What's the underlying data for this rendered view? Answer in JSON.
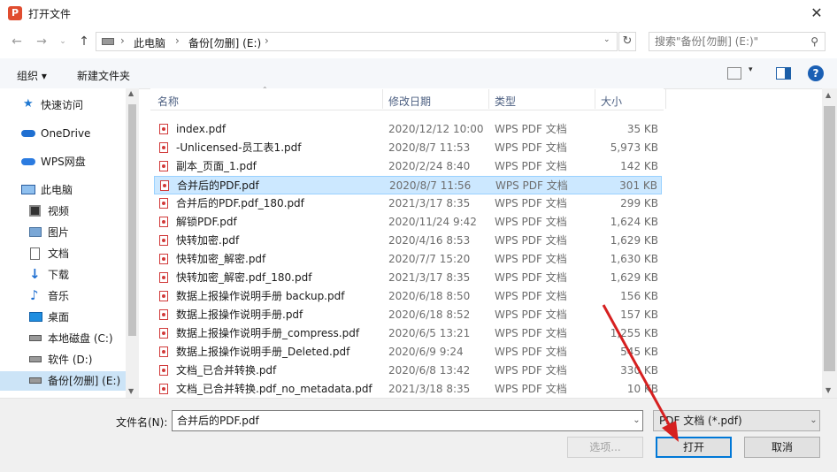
{
  "window": {
    "title": "打开文件",
    "app_icon": "P"
  },
  "address": {
    "path": [
      "此电脑",
      "备份[勿删] (E:)"
    ],
    "search_placeholder": "搜索\"备份[勿删] (E:)\""
  },
  "toolbar": {
    "organize": "组织 ▾",
    "new_folder": "新建文件夹"
  },
  "nav": [
    {
      "label": "快速访问",
      "icon": "star-icon"
    },
    {
      "label": "OneDrive",
      "icon": "cloud-icon"
    },
    {
      "label": "WPS网盘",
      "icon": "cloud-icon"
    },
    {
      "label": "此电脑",
      "icon": "computer-icon"
    },
    {
      "label": "视频",
      "icon": "video-icon"
    },
    {
      "label": "图片",
      "icon": "picture-icon"
    },
    {
      "label": "文档",
      "icon": "document-icon"
    },
    {
      "label": "下载",
      "icon": "download-icon"
    },
    {
      "label": "音乐",
      "icon": "music-icon"
    },
    {
      "label": "桌面",
      "icon": "desktop-icon"
    },
    {
      "label": "本地磁盘 (C:)",
      "icon": "drive-icon"
    },
    {
      "label": "软件 (D:)",
      "icon": "drive-icon"
    },
    {
      "label": "备份[勿删] (E:)",
      "icon": "drive-icon",
      "selected": true
    }
  ],
  "columns": {
    "name": "名称",
    "date": "修改日期",
    "type": "类型",
    "size": "大小"
  },
  "files": [
    {
      "name": "index.pdf",
      "date": "2020/12/12 10:00",
      "type": "WPS PDF 文档",
      "size": "35 KB"
    },
    {
      "name": "-Unlicensed-员工表1.pdf",
      "date": "2020/8/7 11:53",
      "type": "WPS PDF 文档",
      "size": "5,973 KB"
    },
    {
      "name": "副本_页面_1.pdf",
      "date": "2020/2/24 8:40",
      "type": "WPS PDF 文档",
      "size": "142 KB"
    },
    {
      "name": "合并后的PDF.pdf",
      "date": "2020/8/7 11:56",
      "type": "WPS PDF 文档",
      "size": "301 KB",
      "selected": true
    },
    {
      "name": "合并后的PDF.pdf_180.pdf",
      "date": "2021/3/17 8:35",
      "type": "WPS PDF 文档",
      "size": "299 KB"
    },
    {
      "name": "解锁PDF.pdf",
      "date": "2020/11/24 9:42",
      "type": "WPS PDF 文档",
      "size": "1,624 KB"
    },
    {
      "name": "快转加密.pdf",
      "date": "2020/4/16 8:53",
      "type": "WPS PDF 文档",
      "size": "1,629 KB"
    },
    {
      "name": "快转加密_解密.pdf",
      "date": "2020/7/7 15:20",
      "type": "WPS PDF 文档",
      "size": "1,630 KB"
    },
    {
      "name": "快转加密_解密.pdf_180.pdf",
      "date": "2021/3/17 8:35",
      "type": "WPS PDF 文档",
      "size": "1,629 KB"
    },
    {
      "name": "数据上报操作说明手册 backup.pdf",
      "date": "2020/6/18 8:50",
      "type": "WPS PDF 文档",
      "size": "156 KB"
    },
    {
      "name": "数据上报操作说明手册.pdf",
      "date": "2020/6/18 8:52",
      "type": "WPS PDF 文档",
      "size": "157 KB"
    },
    {
      "name": "数据上报操作说明手册_compress.pdf",
      "date": "2020/6/5 13:21",
      "type": "WPS PDF 文档",
      "size": "1,255 KB"
    },
    {
      "name": "数据上报操作说明手册_Deleted.pdf",
      "date": "2020/6/9 9:24",
      "type": "WPS PDF 文档",
      "size": "545 KB"
    },
    {
      "name": "文档_已合并转换.pdf",
      "date": "2020/6/8 13:42",
      "type": "WPS PDF 文档",
      "size": "330 KB"
    },
    {
      "name": "文档_已合并转换.pdf_no_metadata.pdf",
      "date": "2021/3/18 8:35",
      "type": "WPS PDF 文档",
      "size": "10 KB"
    }
  ],
  "bottom": {
    "filename_label": "文件名(N):",
    "filename_value": "合并后的PDF.pdf",
    "filter": "PDF 文档 (*.pdf)",
    "options": "选项...",
    "open": "打开",
    "cancel": "取消"
  },
  "colors": {
    "accent": "#0078d7",
    "selection": "#cce8ff",
    "arrow": "#d62020"
  }
}
